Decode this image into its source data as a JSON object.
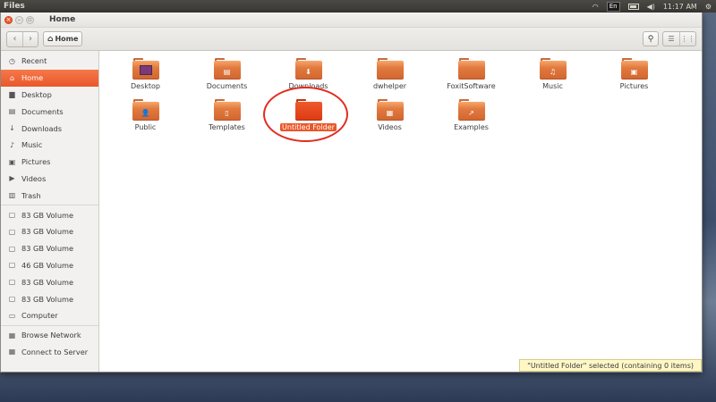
{
  "top_panel": {
    "app_name": "Files",
    "keyboard": "En",
    "time": "11:17 AM"
  },
  "window": {
    "title": "Home"
  },
  "toolbar": {
    "back_glyph": "‹",
    "forward_glyph": "›",
    "path": "Home"
  },
  "sidebar": {
    "items": [
      {
        "label": "Recent",
        "icon": "clock-icon",
        "glyph": "◷"
      },
      {
        "label": "Home",
        "icon": "home-icon",
        "glyph": "⌂",
        "active": true
      },
      {
        "label": "Desktop",
        "icon": "desktop-icon",
        "glyph": "▆"
      },
      {
        "label": "Documents",
        "icon": "documents-icon",
        "glyph": "▤"
      },
      {
        "label": "Downloads",
        "icon": "downloads-icon",
        "glyph": "↓"
      },
      {
        "label": "Music",
        "icon": "music-icon",
        "glyph": "♪"
      },
      {
        "label": "Pictures",
        "icon": "pictures-icon",
        "glyph": "▣"
      },
      {
        "label": "Videos",
        "icon": "videos-icon",
        "glyph": "▶"
      },
      {
        "label": "Trash",
        "icon": "trash-icon",
        "glyph": "▥"
      }
    ],
    "devices": [
      {
        "label": "83 GB Volume",
        "icon": "drive-icon",
        "glyph": "▢"
      },
      {
        "label": "83 GB Volume",
        "icon": "drive-icon",
        "glyph": "▢"
      },
      {
        "label": "83 GB Volume",
        "icon": "drive-icon",
        "glyph": "▢"
      },
      {
        "label": "46 GB Volume",
        "icon": "drive-icon",
        "glyph": "▢"
      },
      {
        "label": "83 GB Volume",
        "icon": "drive-icon",
        "glyph": "▢"
      },
      {
        "label": "83 GB Volume",
        "icon": "drive-icon",
        "glyph": "▢"
      },
      {
        "label": "Computer",
        "icon": "computer-icon",
        "glyph": "▭"
      }
    ],
    "network": [
      {
        "label": "Browse Network",
        "icon": "network-icon",
        "glyph": "▦"
      },
      {
        "label": "Connect to Server",
        "icon": "server-icon",
        "glyph": "▦"
      }
    ]
  },
  "files": [
    {
      "name": "Desktop",
      "emblem": "desktop-emblem",
      "glyph": ""
    },
    {
      "name": "Documents",
      "emblem": "documents-emblem",
      "glyph": "▤"
    },
    {
      "name": "Downloads",
      "emblem": "downloads-emblem",
      "glyph": "⬇"
    },
    {
      "name": "dwhelper",
      "emblem": "none",
      "glyph": ""
    },
    {
      "name": "FoxitSoftware",
      "emblem": "none",
      "glyph": ""
    },
    {
      "name": "Music",
      "emblem": "music-emblem",
      "glyph": "♫"
    },
    {
      "name": "Pictures",
      "emblem": "pictures-emblem",
      "glyph": "▣"
    },
    {
      "name": "Public",
      "emblem": "public-emblem",
      "glyph": "👤"
    },
    {
      "name": "Templates",
      "emblem": "templates-emblem",
      "glyph": "▯"
    },
    {
      "name": "Untitled Folder",
      "emblem": "none",
      "glyph": "",
      "selected": true
    },
    {
      "name": "Videos",
      "emblem": "videos-emblem",
      "glyph": "▦"
    },
    {
      "name": "Examples",
      "emblem": "link-emblem",
      "glyph": "↗"
    }
  ],
  "status": "\"Untitled Folder\" selected  (containing 0 items)",
  "colors": {
    "accent": "#e9572a",
    "folder": "#e07a3f",
    "selected_folder": "#dc3b14",
    "annotation": "#e32b1e"
  }
}
